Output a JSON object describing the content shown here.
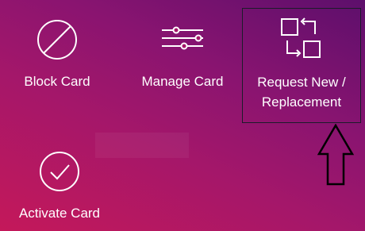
{
  "tiles": {
    "block": {
      "label": "Block Card",
      "icon": "block-icon"
    },
    "manage": {
      "label": "Manage Card",
      "icon": "sliders-icon"
    },
    "request": {
      "label_line1": "Request New /",
      "label_line2": "Replacement",
      "icon": "replace-icon"
    },
    "activate": {
      "label": "Activate Card",
      "icon": "check-circle-icon"
    }
  },
  "annotation": {
    "icon": "up-arrow-icon",
    "color": "#000000"
  },
  "colors": {
    "gradient_start": "#c4185a",
    "gradient_end": "#5d0f6c",
    "foreground": "#ffffff"
  }
}
